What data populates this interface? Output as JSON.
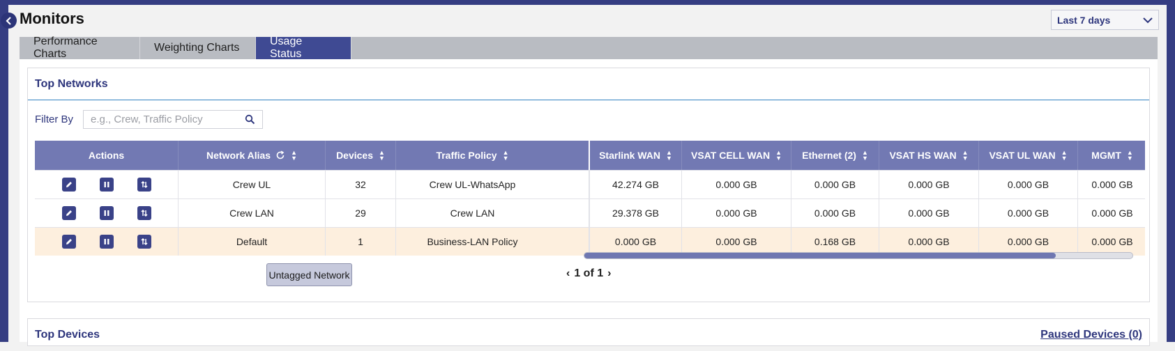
{
  "page": {
    "title": "Monitors",
    "range": "Last 7 days"
  },
  "tabs": [
    {
      "label": "Performance Charts"
    },
    {
      "label": "Weighting Charts"
    },
    {
      "label": "Usage Status"
    }
  ],
  "colors": {
    "primary": "#3f4a93",
    "header": "#7279b3",
    "highlight_row": "#fdefde",
    "link": "#2d357c"
  },
  "top_networks": {
    "title": "Top Networks",
    "filter_label": "Filter By",
    "filter_placeholder": "e.g., Crew, Traffic Policy",
    "columns": {
      "actions": "Actions",
      "network_alias": "Network Alias",
      "devices": "Devices",
      "traffic_policy": "Traffic Policy",
      "starlink": "Starlink WAN",
      "vsat_cell": "VSAT CELL WAN",
      "ethernet": "Ethernet (2)",
      "vsat_hs": "VSAT HS WAN",
      "vsat_ul": "VSAT UL WAN",
      "mgmt": "MGMT"
    },
    "rows": [
      {
        "alias": "Crew UL",
        "devices": "32",
        "policy": "Crew UL-WhatsApp",
        "starlink": "42.274 GB",
        "vsat_cell": "0.000 GB",
        "ethernet": "0.000 GB",
        "vsat_hs": "0.000 GB",
        "vsat_ul": "0.000 GB",
        "mgmt": "0.000 GB"
      },
      {
        "alias": "Crew LAN",
        "devices": "29",
        "policy": "Crew LAN",
        "starlink": "29.378 GB",
        "vsat_cell": "0.000 GB",
        "ethernet": "0.000 GB",
        "vsat_hs": "0.000 GB",
        "vsat_ul": "0.000 GB",
        "mgmt": "0.000 GB"
      },
      {
        "alias": "Default",
        "devices": "1",
        "policy": "Business-LAN Policy",
        "starlink": "0.000 GB",
        "vsat_cell": "0.000 GB",
        "ethernet": "0.168 GB",
        "vsat_hs": "0.000 GB",
        "vsat_ul": "0.000 GB",
        "mgmt": "0.000 GB"
      }
    ],
    "untagged_button": "Untagged Network",
    "pager": "1 of 1",
    "scroll_visible_fraction": 0.86
  },
  "top_devices": {
    "title": "Top Devices",
    "paused_link": "Paused Devices (0)"
  }
}
